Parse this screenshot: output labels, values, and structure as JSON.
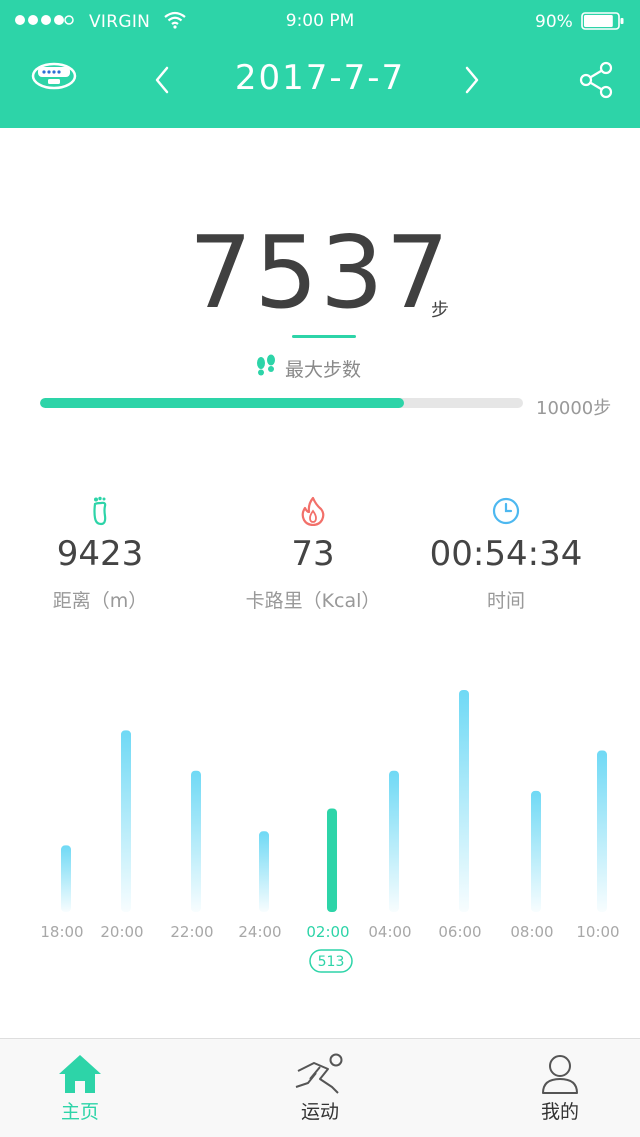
{
  "status_bar": {
    "carrier": "VIRGIN",
    "time": "9:00 PM",
    "battery": "90%",
    "battery_level": 0.9
  },
  "header": {
    "date": "2017-7-7",
    "icons": [
      "band-icon",
      "chevron-left-icon",
      "chevron-right-icon",
      "share-icon"
    ]
  },
  "steps": {
    "count": "7537",
    "unit": "步",
    "max_label": "最大步数",
    "goal": "10000步",
    "progress": 0.7537
  },
  "stats": [
    {
      "icon": "footprint-icon",
      "value": "9423",
      "label": "距离（m）",
      "color": "#2dd4a8"
    },
    {
      "icon": "flame-icon",
      "value": "73",
      "label": "卡路里（Kcal）",
      "color": "#f2706a"
    },
    {
      "icon": "clock-icon",
      "value": "00:54:34",
      "label": "时间",
      "color": "#4db8f0"
    }
  ],
  "chart_data": {
    "type": "bar",
    "categories": [
      "18:00",
      "20:00",
      "22:00",
      "24:00",
      "02:00",
      "04:00",
      "06:00",
      "08:00",
      "10:00"
    ],
    "values": [
      330,
      900,
      700,
      400,
      513,
      700,
      1100,
      600,
      800
    ],
    "selected_index": 4,
    "selected_label": "513",
    "colors": {
      "bar": "#6fd9f5",
      "selected": "#2dd4a8"
    }
  },
  "tabs": [
    {
      "label": "主页",
      "icon": "home-icon",
      "active": true
    },
    {
      "label": "运动",
      "icon": "runner-icon",
      "active": false
    },
    {
      "label": "我的",
      "icon": "person-icon",
      "active": false
    }
  ],
  "colors": {
    "accent": "#2dd4a8",
    "flame": "#f2706a",
    "clock": "#4db8f0"
  }
}
